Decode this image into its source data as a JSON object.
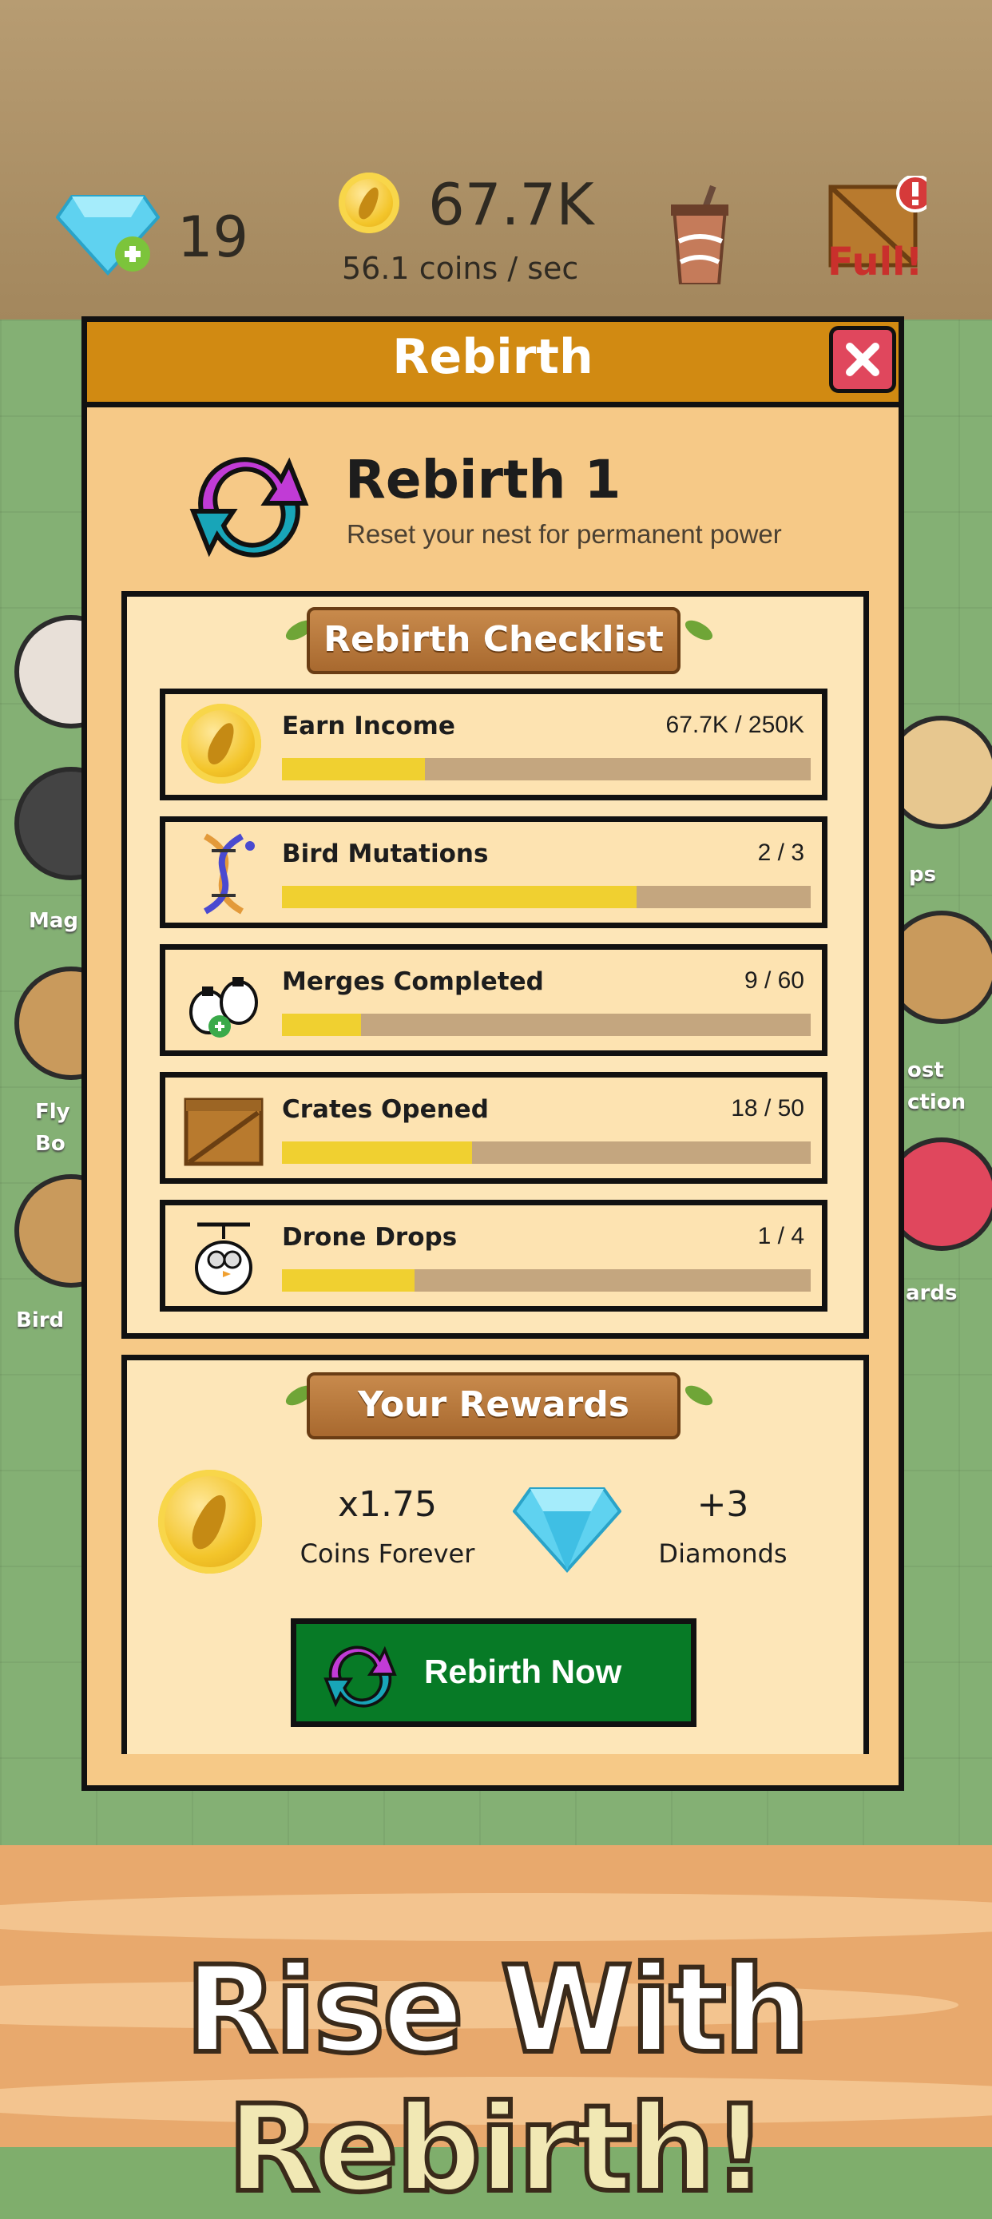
{
  "hud": {
    "diamonds": "19",
    "coins": "67.7K",
    "coins_rate": "56.1 coins / sec",
    "crate_status": "Full!"
  },
  "side_menu": {
    "left": [
      "Mag",
      "Fly\nBo",
      "Bird"
    ],
    "right": [
      "ps",
      "ost\nction",
      "ards"
    ]
  },
  "panel": {
    "title": "Rebirth",
    "heading": "Rebirth 1",
    "subtitle": "Reset your nest for permanent power"
  },
  "checklist": {
    "title": "Rebirth Checklist",
    "items": [
      {
        "label": "Earn Income",
        "value": "67.7K / 250K",
        "progress": 0.27,
        "icon": "coin-icon"
      },
      {
        "label": "Bird Mutations",
        "value": "2 / 3",
        "progress": 0.67,
        "icon": "dna-icon"
      },
      {
        "label": "Merges Completed",
        "value": "9 / 60",
        "progress": 0.15,
        "icon": "merge-birds-icon"
      },
      {
        "label": "Crates Opened",
        "value": "18 / 50",
        "progress": 0.36,
        "icon": "crate-icon"
      },
      {
        "label": "Drone Drops",
        "value": "1 / 4",
        "progress": 0.25,
        "icon": "drone-bird-icon"
      }
    ]
  },
  "rewards": {
    "title": "Your Rewards",
    "coins_multiplier": "x1.75",
    "coins_label": "Coins Forever",
    "diamonds_amount": "+3",
    "diamonds_label": "Diamonds"
  },
  "button": {
    "label": "Rebirth Now"
  },
  "tagline": {
    "part1": "Rise With ",
    "part2": "Rebirth!"
  },
  "colors": {
    "header": "#d18a12",
    "panel": "#f6c987",
    "progress_fill": "#f0d030",
    "progress_track": "#c4a67f",
    "button": "#077a26",
    "close": "#e0475d"
  }
}
